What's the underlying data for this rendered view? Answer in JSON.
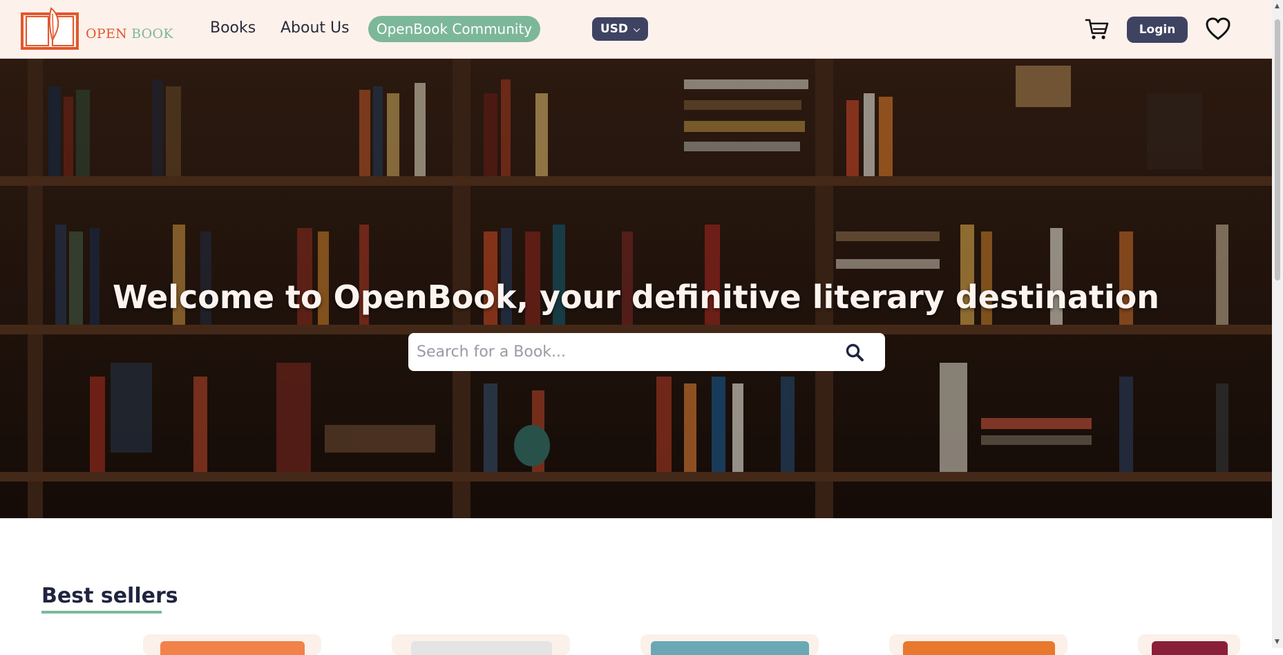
{
  "header": {
    "logo_open": "OPEN",
    "logo_book": "BOOK",
    "nav": {
      "books": "Books",
      "about": "About Us",
      "community": "OpenBook Community"
    },
    "currency": "USD",
    "login": "Login",
    "icons": {
      "cart": "cart-icon",
      "favorites": "heart-icon",
      "currency": "chevron-down-icon"
    }
  },
  "hero": {
    "title_prefix": "Welcome to ",
    "title_brand": "OpenBook",
    "title_suffix": ", your definitive literary destination",
    "search_placeholder": "Search for a Book..."
  },
  "best_sellers": {
    "title": "Best sellers"
  },
  "colors": {
    "header_bg": "#fdf1ec",
    "brand_orange": "#e2572c",
    "brand_green": "#7db79a",
    "navy": "#3f4362"
  }
}
